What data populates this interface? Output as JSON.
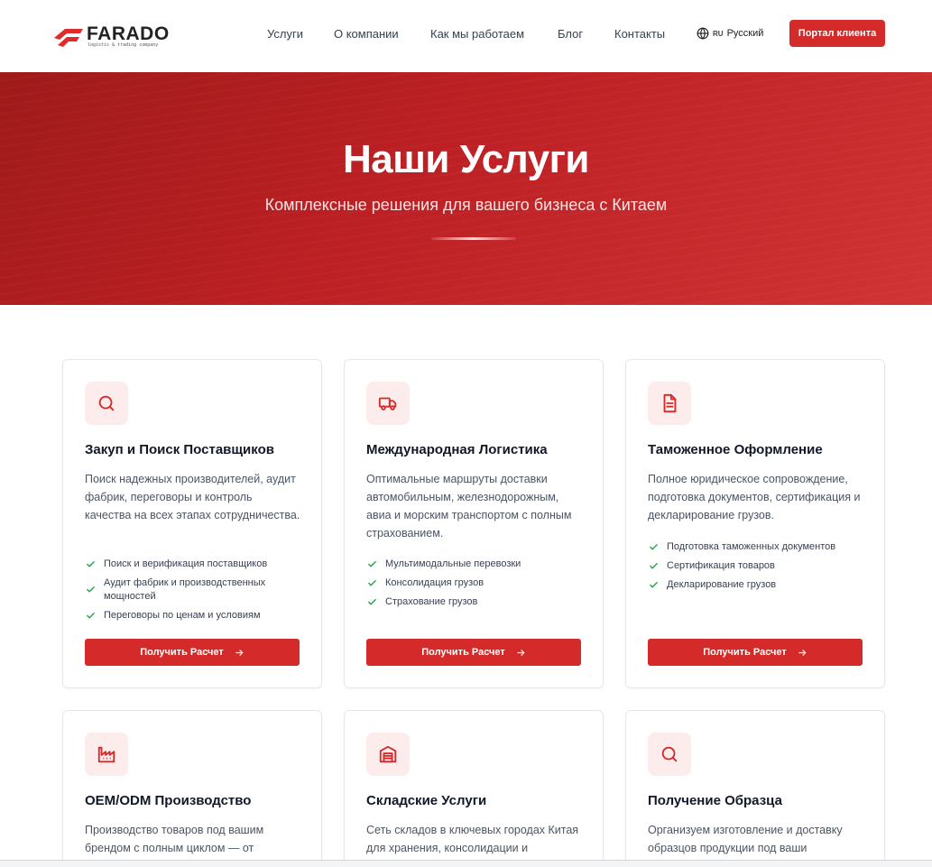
{
  "brand": {
    "name": "FARADO",
    "tagline": "logistic & trading company"
  },
  "nav": {
    "items": [
      {
        "label": "Услуги"
      },
      {
        "label": "О компании"
      },
      {
        "label": "Как мы работаем"
      },
      {
        "label": "Блог"
      },
      {
        "label": "Контакты"
      }
    ],
    "language": {
      "code": "RU",
      "label": "Русский"
    },
    "portal_label": "Портал клиента"
  },
  "hero": {
    "title": "Наши Услуги",
    "subtitle": "Комплексные решения для вашего бизнеса с Китаем"
  },
  "colors": {
    "accent": "#d42a2a",
    "accent_soft": "#fdecec",
    "check": "#22a447"
  },
  "cards": [
    {
      "icon": "search-icon",
      "title": "Закуп и Поиск Поставщиков",
      "description": "Поиск надежных производителей, аудит фабрик, переговоры и контроль качества на всех этапах сотрудничества.",
      "features": [
        "Поиск и верификация поставщиков",
        "Аудит фабрик и производственных мощностей",
        "Переговоры по ценам и условиям"
      ],
      "cta": "Получить Расчет"
    },
    {
      "icon": "truck-icon",
      "title": "Международная Логистика",
      "description": "Оптимальные маршруты доставки автомобильным, железнодорожным, авиа и морским транспортом с полным страхованием.",
      "features": [
        "Мультимодальные перевозки",
        "Консолидация грузов",
        "Страхование грузов"
      ],
      "cta": "Получить Расчет"
    },
    {
      "icon": "document-icon",
      "title": "Таможенное Оформление",
      "description": "Полное юридическое сопровождение, подготовка документов, сертификация и декларирование грузов.",
      "features": [
        "Подготовка таможенных документов",
        "Сертификация товаров",
        "Декларирование грузов"
      ],
      "cta": "Получить Расчет"
    },
    {
      "icon": "factory-icon",
      "title": "OEM/ODM Производство",
      "description": "Производство товаров под вашим брендом с полным циклом — от"
    },
    {
      "icon": "warehouse-icon",
      "title": "Складские Услуги",
      "description": "Сеть складов в ключевых городах Китая для хранения, консолидации и"
    },
    {
      "icon": "search-icon",
      "title": "Получение Образца",
      "description": "Организуем изготовление и доставку образцов продукции под ваши"
    }
  ]
}
